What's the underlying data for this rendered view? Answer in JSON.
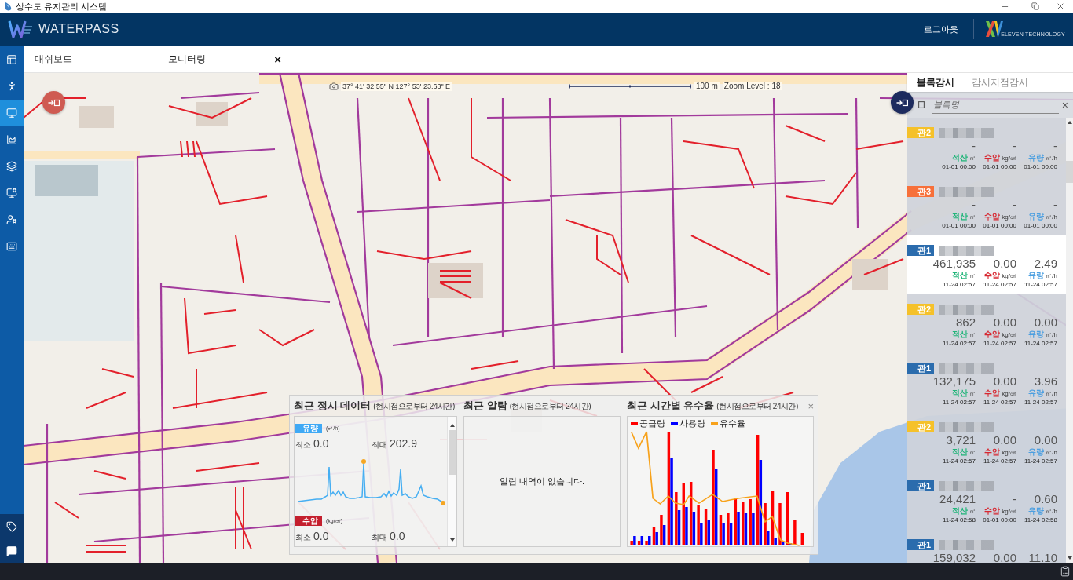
{
  "title_bar": {
    "title": "상수도 유지관리 시스템"
  },
  "header": {
    "brand": "WATERPASS",
    "logout": "로그아웃",
    "company": "ELEVEN TECHNOLOGY"
  },
  "sidebar": {
    "items": [
      {
        "kind": "layout",
        "selected": false
      },
      {
        "kind": "person",
        "selected": false
      },
      {
        "kind": "monitor",
        "selected": true
      },
      {
        "kind": "chart",
        "selected": false
      },
      {
        "kind": "layers",
        "selected": false
      },
      {
        "kind": "screen",
        "selected": false
      },
      {
        "kind": "users",
        "selected": false
      },
      {
        "kind": "keyboard",
        "selected": false
      }
    ],
    "footer_items": [
      {
        "kind": "tag"
      },
      {
        "kind": "chat"
      }
    ]
  },
  "tabs": [
    {
      "label": "대쉬보드"
    },
    {
      "label": "모니터링",
      "close": "×"
    }
  ],
  "map": {
    "coordinates": "37° 41' 32.55\" N 127° 53' 23.63\" E",
    "scale": "100 m",
    "zoom": "Zoom Level : 18"
  },
  "block_panel": {
    "tabs": [
      {
        "label": "블록감시",
        "selected": true
      },
      {
        "label": "감시지점감시",
        "selected": false
      }
    ],
    "search": {
      "placeholder": "블록명",
      "clear": "×"
    },
    "cards": [
      {
        "badge": "관2",
        "color": "#f5c12a",
        "selected": false,
        "measures": [
          {
            "value": "-",
            "label": "적산",
            "unit": "㎥",
            "color": "#22b57a",
            "time": "01-01 00:00"
          },
          {
            "value": "-",
            "label": "수압",
            "unit": "kg/㎠",
            "color": "#d7262f",
            "time": "01-01 00:00"
          },
          {
            "value": "-",
            "label": "유량",
            "unit": "㎥/h",
            "color": "#4c9fe0",
            "time": "01-01 00:00"
          }
        ]
      },
      {
        "badge": "관3",
        "color": "#f7703a",
        "selected": false,
        "measures": [
          {
            "value": "-",
            "label": "적산",
            "unit": "㎥",
            "color": "#22b57a",
            "time": "01-01 00:00"
          },
          {
            "value": "-",
            "label": "수압",
            "unit": "kg/㎠",
            "color": "#d7262f",
            "time": "01-01 00:00"
          },
          {
            "value": "-",
            "label": "유량",
            "unit": "㎥/h",
            "color": "#4c9fe0",
            "time": "01-01 00:00"
          }
        ]
      },
      {
        "badge": "관1",
        "color": "#2b6cad",
        "selected": true,
        "measures": [
          {
            "value": "461,935",
            "label": "적산",
            "unit": "㎥",
            "color": "#22b57a",
            "time": "11-24 02:57"
          },
          {
            "value": "0.00",
            "label": "수압",
            "unit": "kg/㎠",
            "color": "#d7262f",
            "time": "11-24 02:57"
          },
          {
            "value": "2.49",
            "label": "유량",
            "unit": "㎥/h",
            "color": "#4c9fe0",
            "time": "11-24 02:57"
          }
        ]
      },
      {
        "badge": "관2",
        "color": "#f5c12a",
        "selected": false,
        "measures": [
          {
            "value": "862",
            "label": "적산",
            "unit": "㎥",
            "color": "#22b57a",
            "time": "11-24 02:57"
          },
          {
            "value": "0.00",
            "label": "수압",
            "unit": "kg/㎠",
            "color": "#d7262f",
            "time": "11-24 02:57"
          },
          {
            "value": "0.00",
            "label": "유량",
            "unit": "㎥/h",
            "color": "#4c9fe0",
            "time": "11-24 02:57"
          }
        ]
      },
      {
        "badge": "관1",
        "color": "#2b6cad",
        "selected": false,
        "measures": [
          {
            "value": "132,175",
            "label": "적산",
            "unit": "㎥",
            "color": "#22b57a",
            "time": "11-24 02:57"
          },
          {
            "value": "0.00",
            "label": "수압",
            "unit": "kg/㎠",
            "color": "#d7262f",
            "time": "11-24 02:57"
          },
          {
            "value": "3.96",
            "label": "유량",
            "unit": "㎥/h",
            "color": "#4c9fe0",
            "time": "11-24 02:57"
          }
        ]
      },
      {
        "badge": "관2",
        "color": "#f5c12a",
        "selected": false,
        "measures": [
          {
            "value": "3,721",
            "label": "적산",
            "unit": "㎥",
            "color": "#22b57a",
            "time": "11-24 02:57"
          },
          {
            "value": "0.00",
            "label": "수압",
            "unit": "kg/㎠",
            "color": "#d7262f",
            "time": "11-24 02:57"
          },
          {
            "value": "0.00",
            "label": "유량",
            "unit": "㎥/h",
            "color": "#4c9fe0",
            "time": "11-24 02:57"
          }
        ]
      },
      {
        "badge": "관1",
        "color": "#2b6cad",
        "selected": false,
        "measures": [
          {
            "value": "24,421",
            "label": "적산",
            "unit": "㎥",
            "color": "#22b57a",
            "time": "11-24 02:58"
          },
          {
            "value": "-",
            "label": "수압",
            "unit": "kg/㎠",
            "color": "#d7262f",
            "time": "01-01 00:00"
          },
          {
            "value": "0.60",
            "label": "유량",
            "unit": "㎥/h",
            "color": "#4c9fe0",
            "time": "11-24 02:58"
          }
        ]
      },
      {
        "badge": "관1",
        "color": "#2b6cad",
        "selected": false,
        "measures": [
          {
            "value": "159,032"
          },
          {
            "value": "0.00"
          },
          {
            "value": "11.10"
          }
        ]
      }
    ]
  },
  "summary_panel": {
    "sections": [
      {
        "kind": "hourly",
        "title": "최근 정시 데이터",
        "subtitle": "(현시점으로부터 24시간)",
        "metrics": [
          {
            "kind": "chart",
            "badge": "유량",
            "color": "#3fa9f5",
            "unit": "(㎥/h)",
            "min_label": "최소",
            "min": "0.0",
            "max_label": "최대",
            "max": "202.9"
          },
          {
            "kind": "plain",
            "badge": "수압",
            "color": "#c41f2e",
            "unit": "(kg/㎠)",
            "min_label": "최소",
            "min": "0.0",
            "max_label": "최대",
            "max": "0.0"
          }
        ]
      },
      {
        "kind": "alarms",
        "title": "최근 알람",
        "subtitle": "(현시점으로부터 24시간)",
        "empty": "알림 내역이 없습니다."
      },
      {
        "kind": "ratio",
        "title": "최근 시간별 유수율",
        "subtitle": "(현시점으로부터 24시간)",
        "close": "×",
        "legend": [
          {
            "label": "공급량",
            "color": "#ff0000"
          },
          {
            "label": "사용량",
            "color": "#0000ff"
          },
          {
            "label": "유수율",
            "color": "#f7a21b"
          }
        ]
      }
    ]
  }
}
